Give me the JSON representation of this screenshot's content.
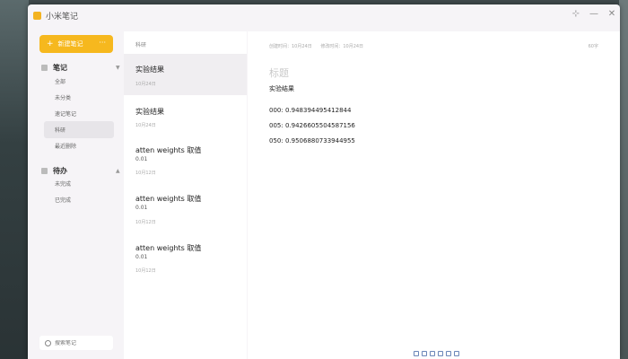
{
  "window": {
    "title": "小米笔记",
    "controls": {
      "pin": "⊹",
      "minimize": "—",
      "close": "✕"
    }
  },
  "sidebar": {
    "new_note_label": "新建笔记",
    "new_note_more": "···",
    "notes_section": "笔记",
    "note_items": [
      {
        "label": "全部",
        "active": false
      },
      {
        "label": "未分类",
        "active": false
      },
      {
        "label": "速记笔记",
        "active": false
      },
      {
        "label": "科研",
        "active": true
      },
      {
        "label": "最近删除",
        "active": false
      }
    ],
    "todo_section": "待办",
    "todo_items": [
      {
        "label": "未完成"
      },
      {
        "label": "已完成"
      }
    ],
    "search_placeholder": "搜索笔记"
  },
  "list": {
    "header": "科研",
    "notes": [
      {
        "title": "实验结果",
        "preview": "",
        "date": "10月24日",
        "active": true
      },
      {
        "title": "实验结果",
        "preview": "",
        "date": "10月24日",
        "active": false
      },
      {
        "title": "atten weights 取值",
        "preview": "0.01",
        "date": "10月12日",
        "active": false
      },
      {
        "title": "atten weights 取值",
        "preview": "0.01",
        "date": "10月12日",
        "active": false
      },
      {
        "title": "atten weights 取值",
        "preview": "0.01",
        "date": "10月12日",
        "active": false
      }
    ]
  },
  "editor": {
    "created": "创建时间：10月24日",
    "modified": "修改时间：10月24日",
    "char_count": "60字",
    "title_placeholder": "标题",
    "subtitle": "实验结果",
    "lines": [
      "000: 0.948394495412844",
      "005: 0.9426605504587156",
      "050: 0.9506880733944955"
    ]
  },
  "colors": {
    "accent": "#f6b81e",
    "toolbar_icon": "#6a86b8"
  },
  "icons": {
    "app": "notes-app-icon",
    "search": "search-icon",
    "pin": "pin-icon",
    "notes_section": "notes-icon",
    "todo_section": "todo-icon"
  }
}
